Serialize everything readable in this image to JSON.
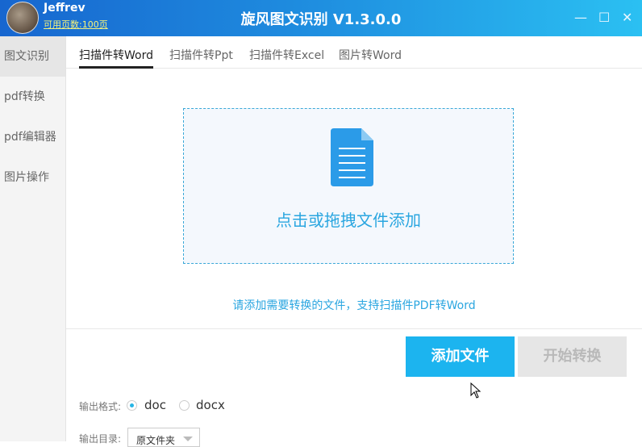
{
  "app": {
    "title": "旋风图文识别 V1.3.0.0",
    "user": "Jeffrev",
    "pages_left": "可用页数:100页"
  },
  "window_controls": {
    "minimize": "—",
    "maximize": "☐",
    "close": "✕"
  },
  "sidebar": {
    "items": [
      {
        "label": "图文识别"
      },
      {
        "label": "pdf转换"
      },
      {
        "label": "pdf编辑器"
      },
      {
        "label": "图片操作"
      }
    ]
  },
  "tabs": [
    {
      "label": "扫描件转Word"
    },
    {
      "label": "扫描件转Ppt"
    },
    {
      "label": "扫描件转Excel"
    },
    {
      "label": "图片转Word"
    }
  ],
  "dropzone": {
    "text": "点击或拖拽文件添加"
  },
  "hint": "请添加需要转换的文件，支持扫描件PDF转Word",
  "buttons": {
    "add": "添加文件",
    "start": "开始转换"
  },
  "output": {
    "format_label": "输出格式:",
    "formats": [
      "doc",
      "docx"
    ],
    "selected": "doc",
    "dir_label": "输出目录:",
    "dir_value": "原文件夹"
  },
  "colors": {
    "accent": "#1cb4ef"
  }
}
